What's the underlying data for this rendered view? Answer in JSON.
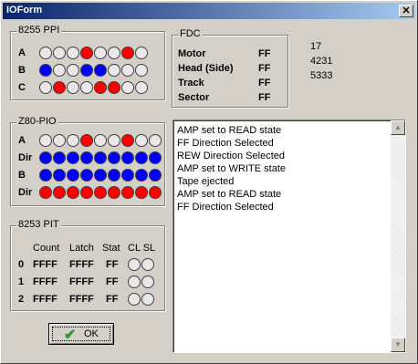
{
  "window": {
    "title": "IOForm",
    "close_label": "✕"
  },
  "ppi": {
    "title": "8255 PPI",
    "rows": [
      {
        "label": "A",
        "leds": [
          "off",
          "off",
          "off",
          "red",
          "off",
          "off",
          "red",
          "off"
        ]
      },
      {
        "label": "B",
        "leds": [
          "blue",
          "off",
          "off",
          "blue",
          "blue",
          "off",
          "off",
          "off"
        ]
      },
      {
        "label": "C",
        "leds": [
          "off",
          "red",
          "off",
          "off",
          "red",
          "red",
          "off",
          "off"
        ]
      }
    ]
  },
  "fdc": {
    "title": "FDC",
    "items": [
      {
        "label": "Motor",
        "value": "FF"
      },
      {
        "label": "Head (Side)",
        "value": "FF"
      },
      {
        "label": "Track",
        "value": "FF"
      },
      {
        "label": "Sector",
        "value": "FF"
      }
    ]
  },
  "info": [
    "17",
    "4231",
    "5333"
  ],
  "pio": {
    "title": "Z80-PIO",
    "rows": [
      {
        "label": "A",
        "leds": [
          "off",
          "off",
          "off",
          "red",
          "off",
          "off",
          "red",
          "off",
          "off"
        ]
      },
      {
        "label": "Dir",
        "leds": [
          "blue",
          "blue",
          "blue",
          "blue",
          "blue",
          "blue",
          "blue",
          "blue",
          "blue"
        ]
      },
      {
        "label": "B",
        "leds": [
          "blue",
          "blue",
          "blue",
          "blue",
          "blue",
          "blue",
          "blue",
          "blue",
          "blue"
        ]
      },
      {
        "label": "Dir",
        "leds": [
          "red",
          "red",
          "red",
          "red",
          "red",
          "red",
          "red",
          "red",
          "red"
        ]
      }
    ]
  },
  "pit": {
    "title": "8253 PIT",
    "headers": {
      "count": "Count",
      "latch": "Latch",
      "stat": "Stat",
      "clsl": "CL SL"
    },
    "rows": [
      {
        "index": "0",
        "count": "FFFF",
        "latch": "FFFF",
        "stat": "FF",
        "cl": "off",
        "sl": "off"
      },
      {
        "index": "1",
        "count": "FFFF",
        "latch": "FFFF",
        "stat": "FF",
        "cl": "off",
        "sl": "off"
      },
      {
        "index": "2",
        "count": "FFFF",
        "latch": "FFFF",
        "stat": "FF",
        "cl": "off",
        "sl": "off"
      }
    ]
  },
  "log": [
    "AMP set to READ state",
    "FF Direction Selected",
    "REW Direction Selected",
    "AMP set to WRITE state",
    "Tape ejected",
    "AMP set to READ state",
    "FF Direction Selected"
  ],
  "ok_button": {
    "label": "OK"
  },
  "colors": {
    "led_red": "#ff0000",
    "led_blue": "#0000ff",
    "led_off": "#e8e8e8",
    "titlebar": "#0a246a"
  }
}
